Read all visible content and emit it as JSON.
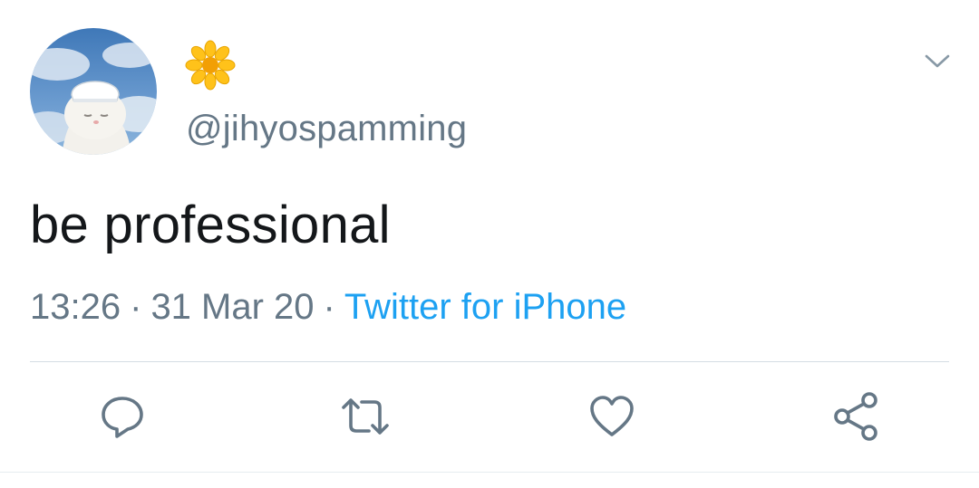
{
  "tweet": {
    "display_name_icon": "sunflower-emoji-icon",
    "handle": "@jihyospamming",
    "text": "be professional",
    "time": "13:26",
    "separator": "·",
    "date": "31 Mar 20",
    "source": "Twitter for iPhone"
  },
  "actions": {
    "reply_icon": "reply-icon",
    "retweet_icon": "retweet-icon",
    "like_icon": "heart-icon",
    "share_icon": "share-icon"
  },
  "colors": {
    "text": "#14171a",
    "secondary": "#657786",
    "link": "#1da1f2",
    "icon": "#657786",
    "divider": "#d4dde4"
  }
}
